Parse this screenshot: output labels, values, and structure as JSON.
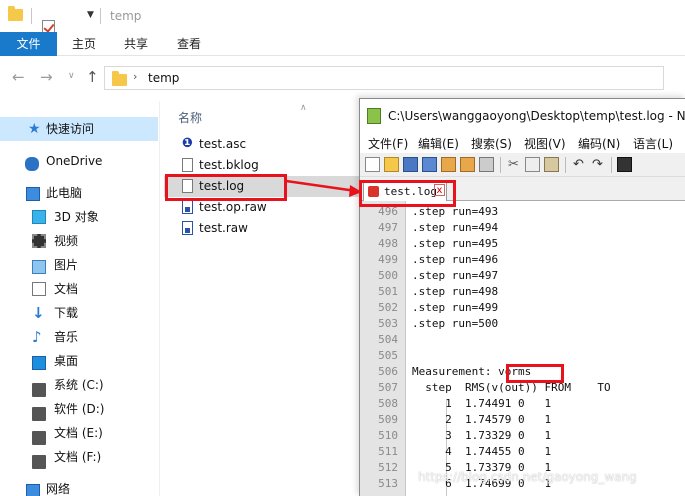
{
  "explorer": {
    "title": "temp",
    "ribbon_tabs": [
      "文件",
      "主页",
      "共享",
      "查看"
    ],
    "address": "temp",
    "nav_items": [
      {
        "label": "快速访问",
        "icon": "star-icon"
      },
      {
        "label": "OneDrive",
        "icon": "cloud-icon"
      },
      {
        "label": "此电脑",
        "icon": "computer-icon"
      },
      {
        "label": "3D 对象",
        "icon": "cube-icon"
      },
      {
        "label": "视频",
        "icon": "video-icon"
      },
      {
        "label": "图片",
        "icon": "picture-icon"
      },
      {
        "label": "文档",
        "icon": "document-icon"
      },
      {
        "label": "下载",
        "icon": "download-icon"
      },
      {
        "label": "音乐",
        "icon": "music-icon"
      },
      {
        "label": "桌面",
        "icon": "desktop-icon"
      },
      {
        "label": "系统 (C:)",
        "icon": "drive-icon"
      },
      {
        "label": "软件 (D:)",
        "icon": "drive-icon"
      },
      {
        "label": "文档 (E:)",
        "icon": "drive-icon"
      },
      {
        "label": "文档 (F:)",
        "icon": "drive-icon"
      },
      {
        "label": "网络",
        "icon": "network-icon"
      }
    ],
    "column_header": "名称",
    "files": [
      {
        "name": "test.asc",
        "icon": "ltspice-schematic-icon"
      },
      {
        "name": "test.bklog",
        "icon": "text-file-icon"
      },
      {
        "name": "test.log",
        "icon": "text-file-icon",
        "selected": true
      },
      {
        "name": "test.op.raw",
        "icon": "raw-file-icon"
      },
      {
        "name": "test.raw",
        "icon": "raw-file-icon"
      }
    ]
  },
  "notepad": {
    "title": "C:\\Users\\wanggaoyong\\Desktop\\temp\\test.log - N",
    "menu": [
      "文件(F)",
      "编辑(E)",
      "搜索(S)",
      "视图(V)",
      "编码(N)",
      "语言(L)"
    ],
    "tab_label": "test.log",
    "tab_close": "x",
    "lines": [
      {
        "num": "496",
        "text": ".step run=493"
      },
      {
        "num": "497",
        "text": ".step run=494"
      },
      {
        "num": "498",
        "text": ".step run=495"
      },
      {
        "num": "499",
        "text": ".step run=496"
      },
      {
        "num": "500",
        "text": ".step run=497"
      },
      {
        "num": "501",
        "text": ".step run=498"
      },
      {
        "num": "502",
        "text": ".step run=499"
      },
      {
        "num": "503",
        "text": ".step run=500"
      },
      {
        "num": "504",
        "text": ""
      },
      {
        "num": "505",
        "text": ""
      },
      {
        "num": "506",
        "text": "Measurement: vorms"
      },
      {
        "num": "507",
        "text": "  step  RMS(v(out)) FROM    TO"
      },
      {
        "num": "508",
        "text": "     1  1.74491 0   1"
      },
      {
        "num": "509",
        "text": "     2  1.74579 0   1"
      },
      {
        "num": "510",
        "text": "     3  1.73329 0   1"
      },
      {
        "num": "511",
        "text": "     4  1.74455 0   1"
      },
      {
        "num": "512",
        "text": "     5  1.73379 0   1"
      },
      {
        "num": "513",
        "text": "     6  1.74699 0   1"
      }
    ]
  },
  "watermark": "https://blog.csdn.net/gaoyong_wang",
  "colors": {
    "accent": "#1979ca",
    "highlight": "#e8121c",
    "selection": "#cce8ff"
  }
}
